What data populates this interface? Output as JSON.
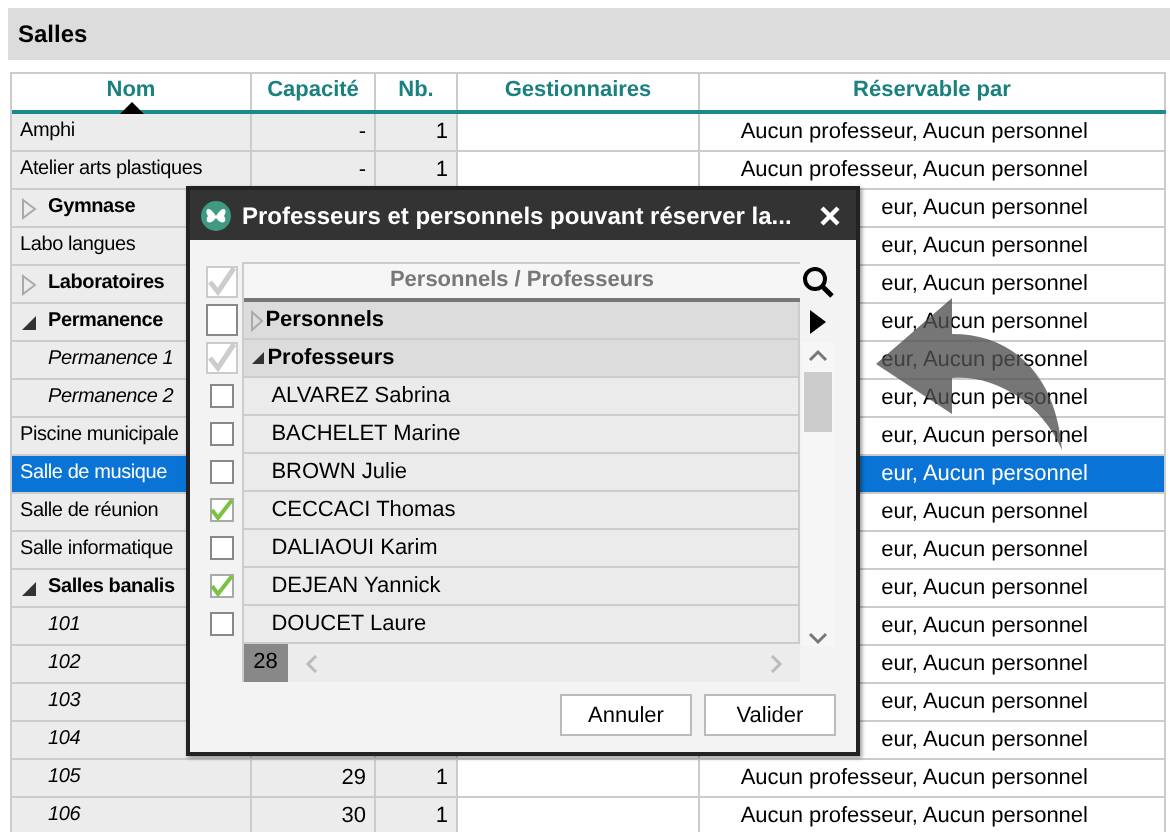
{
  "panel": {
    "title": "Salles"
  },
  "table": {
    "columns": [
      {
        "label": "Nom",
        "sorted": true
      },
      {
        "label": "Capacité",
        "sorted": false
      },
      {
        "label": "Nb.",
        "sorted": false
      },
      {
        "label": "Gestionnaires",
        "sorted": false
      },
      {
        "label": "Réservable par",
        "sorted": false
      }
    ],
    "rows": [
      {
        "kind": "item",
        "name": "Amphi",
        "capacity": "-",
        "count": "1",
        "reservable": "Aucun professeur, Aucun personnel",
        "selected": false
      },
      {
        "kind": "item",
        "name": "Atelier arts plastiques",
        "capacity": "-",
        "count": "1",
        "reservable": "Aucun professeur, Aucun personnel",
        "selected": false
      },
      {
        "kind": "group",
        "name": "Gymnase",
        "expanded": false,
        "reservable": "eur, Aucun personnel",
        "selected": false
      },
      {
        "kind": "item",
        "name": "Labo langues",
        "reservable": "eur, Aucun personnel",
        "selected": false
      },
      {
        "kind": "group",
        "name": "Laboratoires",
        "expanded": false,
        "reservable": "eur, Aucun personnel",
        "selected": false
      },
      {
        "kind": "group",
        "name": "Permanence",
        "expanded": true,
        "reservable": "eur, Aucun personnel",
        "selected": false,
        "children": [
          {
            "kind": "item",
            "name": "Permanence 1",
            "reservable": "eur, Aucun personnel",
            "selected": false
          },
          {
            "kind": "item",
            "name": "Permanence 2",
            "reservable": "eur, Aucun personnel",
            "selected": false
          }
        ]
      },
      {
        "kind": "item",
        "name": "Piscine municipale",
        "reservable": "eur, Aucun personnel",
        "selected": false
      },
      {
        "kind": "item",
        "name": "Salle de musique",
        "reservable": "eur, Aucun personnel",
        "selected": true
      },
      {
        "kind": "item",
        "name": "Salle de réunion",
        "reservable": "eur, Aucun personnel",
        "selected": false
      },
      {
        "kind": "item",
        "name": "Salle informatique",
        "reservable": "eur, Aucun personnel",
        "selected": false
      },
      {
        "kind": "group",
        "name": "Salles banalis",
        "expanded": true,
        "reservable": "eur, Aucun personnel",
        "selected": false,
        "children": [
          {
            "kind": "item",
            "name": "101",
            "reservable": "eur, Aucun personnel",
            "selected": false
          },
          {
            "kind": "item",
            "name": "102",
            "reservable": "eur, Aucun personnel",
            "selected": false
          },
          {
            "kind": "item",
            "name": "103",
            "reservable": "eur, Aucun personnel",
            "selected": false
          },
          {
            "kind": "item",
            "name": "104",
            "reservable": "eur, Aucun personnel",
            "selected": false
          },
          {
            "kind": "item",
            "name": "105",
            "capacity": "29",
            "count": "1",
            "reservable": "Aucun professeur, Aucun personnel",
            "selected": false
          },
          {
            "kind": "item",
            "name": "106",
            "capacity": "30",
            "count": "1",
            "reservable": "Aucun professeur, Aucun personnel",
            "selected": false
          }
        ]
      }
    ]
  },
  "dialog": {
    "title": "Professeurs et personnels pouvant réserver la...",
    "header": "Personnels / Professeurs",
    "all_checked": true,
    "groups": [
      {
        "name": "Personnels",
        "expanded": false,
        "checked": false
      },
      {
        "name": "Professeurs",
        "expanded": true,
        "checked": true,
        "children": [
          {
            "name": "ALVAREZ Sabrina",
            "checked": false
          },
          {
            "name": "BACHELET Marine",
            "checked": false
          },
          {
            "name": "BROWN Julie",
            "checked": false
          },
          {
            "name": "CECCACI Thomas",
            "checked": true
          },
          {
            "name": "DALIAOUI Karim",
            "checked": false
          },
          {
            "name": "DEJEAN Yannick",
            "checked": true
          },
          {
            "name": "DOUCET Laure",
            "checked": false
          }
        ]
      }
    ],
    "count": "28",
    "buttons": [
      "Annuler",
      "Valider"
    ]
  }
}
